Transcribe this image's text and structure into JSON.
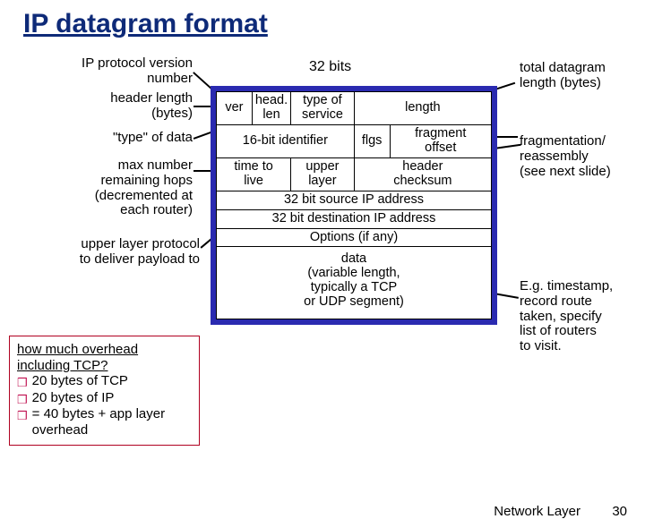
{
  "title": "IP datagram format",
  "bits_label": "32 bits",
  "left_annotations": {
    "a0": "IP protocol version\nnumber",
    "a1": "header length\n(bytes)",
    "a2": "\"type\" of data",
    "a3": "max number\nremaining hops\n(decremented at\neach router)",
    "a4": "upper layer protocol\nto deliver payload to"
  },
  "right_annotations": {
    "r0": "total datagram\nlength (bytes)",
    "r1": "fragmentation/\nreassembly\n(see next slide)",
    "r2": "E.g. timestamp,\nrecord route\ntaken, specify\nlist of routers\nto visit."
  },
  "header": {
    "ver": "ver",
    "hlen": "head.\nlen",
    "tos": "type of\nservice",
    "length": "length",
    "id": "16-bit identifier",
    "flgs": "flgs",
    "frag": "fragment\noffset",
    "ttl": "time to\nlive",
    "upper": "upper\nlayer",
    "cksum": "header\nchecksum",
    "src": "32 bit source IP address",
    "dst": "32 bit destination IP address",
    "opts": "Options (if any)",
    "data": "data\n(variable length,\ntypically a TCP\nor UDP segment)"
  },
  "overhead": {
    "q": "how much overhead including TCP?",
    "b1": "20 bytes of TCP",
    "b2": "20 bytes of IP",
    "b3": "= 40 bytes + app layer overhead"
  },
  "footer": {
    "section": "Network Layer",
    "page": "30"
  }
}
